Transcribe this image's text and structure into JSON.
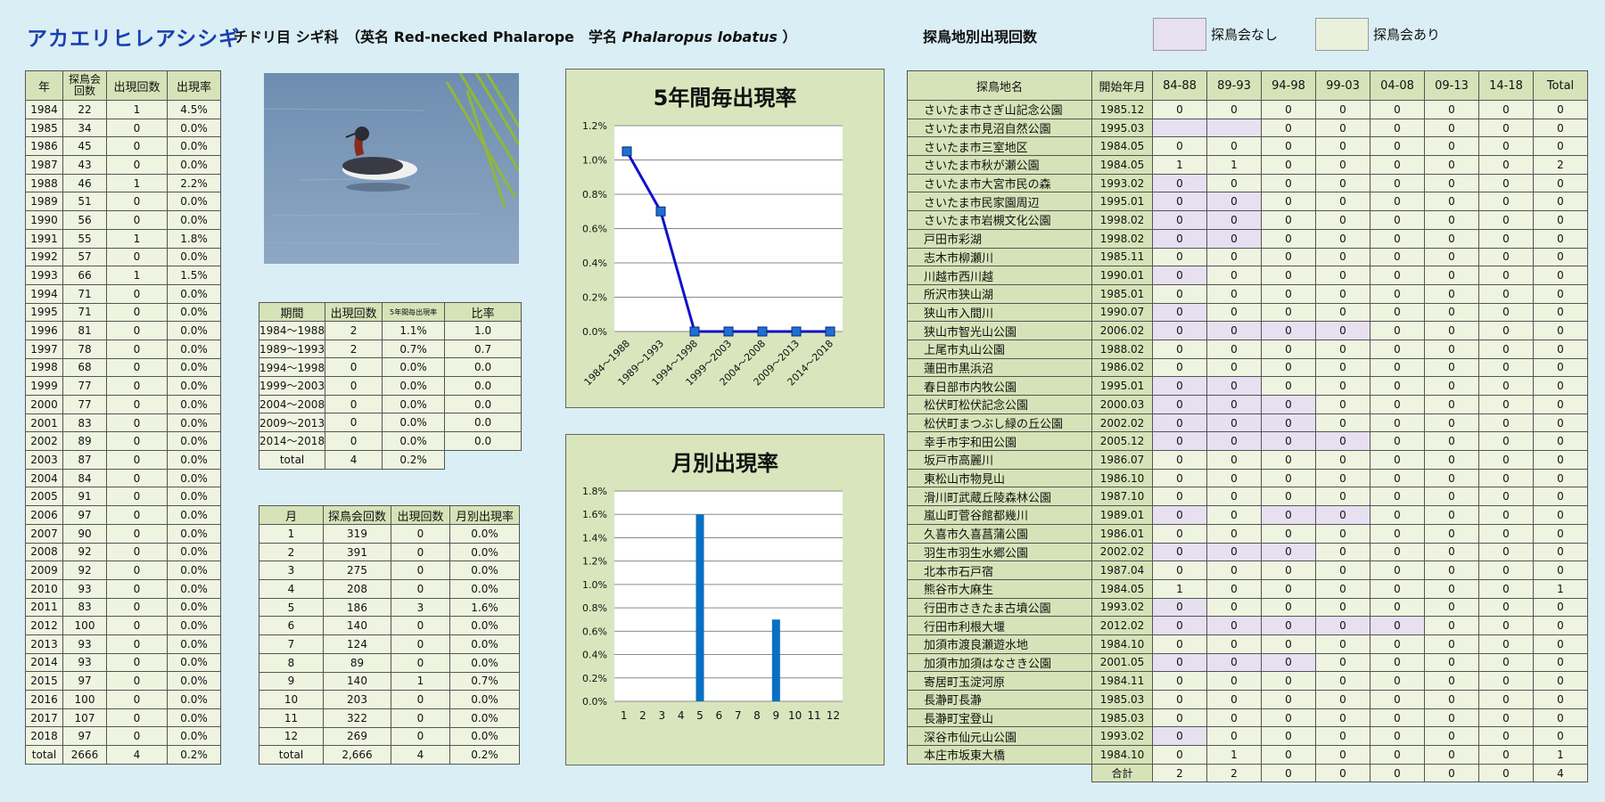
{
  "header": {
    "species": "アカエリヒレアシシギ",
    "order_family": "チドリ目 シギ科",
    "names_open": "（英名 Red-necked Phalarope　学名 ",
    "scientific": "Phalaropus lobatus",
    "names_close": " ）",
    "sites_title": "探鳥地別出現回数",
    "legend_no": "探鳥会なし",
    "legend_yes": "探鳥会あり"
  },
  "colors": {
    "no_meeting": "#e6e0f0",
    "meeting": "#e9f1dd",
    "line": "#1212c8",
    "bar": "#0a6fc2"
  },
  "years_table": {
    "headers": [
      "年",
      "探鳥会回数",
      "出現回数",
      "出現率"
    ],
    "rows": [
      [
        "1984",
        "22",
        "1",
        "4.5%"
      ],
      [
        "1985",
        "34",
        "0",
        "0.0%"
      ],
      [
        "1986",
        "45",
        "0",
        "0.0%"
      ],
      [
        "1987",
        "43",
        "0",
        "0.0%"
      ],
      [
        "1988",
        "46",
        "1",
        "2.2%"
      ],
      [
        "1989",
        "51",
        "0",
        "0.0%"
      ],
      [
        "1990",
        "56",
        "0",
        "0.0%"
      ],
      [
        "1991",
        "55",
        "1",
        "1.8%"
      ],
      [
        "1992",
        "57",
        "0",
        "0.0%"
      ],
      [
        "1993",
        "66",
        "1",
        "1.5%"
      ],
      [
        "1994",
        "71",
        "0",
        "0.0%"
      ],
      [
        "1995",
        "71",
        "0",
        "0.0%"
      ],
      [
        "1996",
        "81",
        "0",
        "0.0%"
      ],
      [
        "1997",
        "78",
        "0",
        "0.0%"
      ],
      [
        "1998",
        "68",
        "0",
        "0.0%"
      ],
      [
        "1999",
        "77",
        "0",
        "0.0%"
      ],
      [
        "2000",
        "77",
        "0",
        "0.0%"
      ],
      [
        "2001",
        "83",
        "0",
        "0.0%"
      ],
      [
        "2002",
        "89",
        "0",
        "0.0%"
      ],
      [
        "2003",
        "87",
        "0",
        "0.0%"
      ],
      [
        "2004",
        "84",
        "0",
        "0.0%"
      ],
      [
        "2005",
        "91",
        "0",
        "0.0%"
      ],
      [
        "2006",
        "97",
        "0",
        "0.0%"
      ],
      [
        "2007",
        "90",
        "0",
        "0.0%"
      ],
      [
        "2008",
        "92",
        "0",
        "0.0%"
      ],
      [
        "2009",
        "92",
        "0",
        "0.0%"
      ],
      [
        "2010",
        "93",
        "0",
        "0.0%"
      ],
      [
        "2011",
        "83",
        "0",
        "0.0%"
      ],
      [
        "2012",
        "100",
        "0",
        "0.0%"
      ],
      [
        "2013",
        "93",
        "0",
        "0.0%"
      ],
      [
        "2014",
        "93",
        "0",
        "0.0%"
      ],
      [
        "2015",
        "97",
        "0",
        "0.0%"
      ],
      [
        "2016",
        "100",
        "0",
        "0.0%"
      ],
      [
        "2017",
        "107",
        "0",
        "0.0%"
      ],
      [
        "2018",
        "97",
        "0",
        "0.0%"
      ],
      [
        "total",
        "2666",
        "4",
        "0.2%"
      ]
    ]
  },
  "period_table": {
    "headers": [
      "期間",
      "出現回数",
      "5年間毎出現率",
      "比率"
    ],
    "rows": [
      [
        "1984～1988",
        "2",
        "1.1%",
        "1.0"
      ],
      [
        "1989～1993",
        "2",
        "0.7%",
        "0.7"
      ],
      [
        "1994～1998",
        "0",
        "0.0%",
        "0.0"
      ],
      [
        "1999～2003",
        "0",
        "0.0%",
        "0.0"
      ],
      [
        "2004～2008",
        "0",
        "0.0%",
        "0.0"
      ],
      [
        "2009～2013",
        "0",
        "0.0%",
        "0.0"
      ],
      [
        "2014～2018",
        "0",
        "0.0%",
        "0.0"
      ]
    ],
    "total": [
      "total",
      "4",
      "0.2%"
    ]
  },
  "month_table": {
    "headers": [
      "月",
      "探鳥会回数",
      "出現回数",
      "月別出現率"
    ],
    "rows": [
      [
        "1",
        "319",
        "0",
        "0.0%"
      ],
      [
        "2",
        "391",
        "0",
        "0.0%"
      ],
      [
        "3",
        "275",
        "0",
        "0.0%"
      ],
      [
        "4",
        "208",
        "0",
        "0.0%"
      ],
      [
        "5",
        "186",
        "3",
        "1.6%"
      ],
      [
        "6",
        "140",
        "0",
        "0.0%"
      ],
      [
        "7",
        "124",
        "0",
        "0.0%"
      ],
      [
        "8",
        "89",
        "0",
        "0.0%"
      ],
      [
        "9",
        "140",
        "1",
        "0.7%"
      ],
      [
        "10",
        "203",
        "0",
        "0.0%"
      ],
      [
        "11",
        "322",
        "0",
        "0.0%"
      ],
      [
        "12",
        "269",
        "0",
        "0.0%"
      ],
      [
        "total",
        "2,666",
        "4",
        "0.2%"
      ]
    ]
  },
  "sites_table": {
    "headers": [
      "探鳥地名",
      "開始年月",
      "84-88",
      "89-93",
      "94-98",
      "99-03",
      "04-08",
      "09-13",
      "14-18",
      "Total"
    ],
    "rows": [
      {
        "name": "さいたま市さぎ山記念公園",
        "start": "1985.12",
        "v": [
          "0",
          "0",
          "0",
          "0",
          "0",
          "0",
          "0",
          "0"
        ],
        "nm": []
      },
      {
        "name": "さいたま市見沼自然公園",
        "start": "1995.03",
        "v": [
          "",
          "",
          "0",
          "0",
          "0",
          "0",
          "0",
          "0"
        ],
        "nm": [
          0,
          1
        ]
      },
      {
        "name": "さいたま市三室地区",
        "start": "1984.05",
        "v": [
          "0",
          "0",
          "0",
          "0",
          "0",
          "0",
          "0",
          "0"
        ],
        "nm": []
      },
      {
        "name": "さいたま市秋が瀬公園",
        "start": "1984.05",
        "v": [
          "1",
          "1",
          "0",
          "0",
          "0",
          "0",
          "0",
          "2"
        ],
        "nm": []
      },
      {
        "name": "さいたま市大宮市民の森",
        "start": "1993.02",
        "v": [
          "0",
          "0",
          "0",
          "0",
          "0",
          "0",
          "0",
          "0"
        ],
        "nm": [
          0
        ]
      },
      {
        "name": "さいたま市民家園周辺",
        "start": "1995.01",
        "v": [
          "0",
          "0",
          "0",
          "0",
          "0",
          "0",
          "0",
          "0"
        ],
        "nm": [
          0,
          1
        ]
      },
      {
        "name": "さいたま市岩槻文化公園",
        "start": "1998.02",
        "v": [
          "0",
          "0",
          "0",
          "0",
          "0",
          "0",
          "0",
          "0"
        ],
        "nm": [
          0,
          1
        ]
      },
      {
        "name": "戸田市彩湖",
        "start": "1998.02",
        "v": [
          "0",
          "0",
          "0",
          "0",
          "0",
          "0",
          "0",
          "0"
        ],
        "nm": [
          0,
          1
        ]
      },
      {
        "name": "志木市柳瀬川",
        "start": "1985.11",
        "v": [
          "0",
          "0",
          "0",
          "0",
          "0",
          "0",
          "0",
          "0"
        ],
        "nm": []
      },
      {
        "name": "川越市西川越",
        "start": "1990.01",
        "v": [
          "0",
          "0",
          "0",
          "0",
          "0",
          "0",
          "0",
          "0"
        ],
        "nm": [
          0
        ]
      },
      {
        "name": "所沢市狭山湖",
        "start": "1985.01",
        "v": [
          "0",
          "0",
          "0",
          "0",
          "0",
          "0",
          "0",
          "0"
        ],
        "nm": []
      },
      {
        "name": "狭山市入間川",
        "start": "1990.07",
        "v": [
          "0",
          "0",
          "0",
          "0",
          "0",
          "0",
          "0",
          "0"
        ],
        "nm": [
          0
        ]
      },
      {
        "name": "狭山市智光山公園",
        "start": "2006.02",
        "v": [
          "0",
          "0",
          "0",
          "0",
          "0",
          "0",
          "0",
          "0"
        ],
        "nm": [
          0,
          1,
          2,
          3
        ]
      },
      {
        "name": "上尾市丸山公園",
        "start": "1988.02",
        "v": [
          "0",
          "0",
          "0",
          "0",
          "0",
          "0",
          "0",
          "0"
        ],
        "nm": []
      },
      {
        "name": "蓮田市黒浜沼",
        "start": "1986.02",
        "v": [
          "0",
          "0",
          "0",
          "0",
          "0",
          "0",
          "0",
          "0"
        ],
        "nm": []
      },
      {
        "name": "春日部市内牧公園",
        "start": "1995.01",
        "v": [
          "0",
          "0",
          "0",
          "0",
          "0",
          "0",
          "0",
          "0"
        ],
        "nm": [
          0,
          1
        ]
      },
      {
        "name": "松伏町松伏記念公園",
        "start": "2000.03",
        "v": [
          "0",
          "0",
          "0",
          "0",
          "0",
          "0",
          "0",
          "0"
        ],
        "nm": [
          0,
          1,
          2
        ]
      },
      {
        "name": "松伏町まつぶし緑の丘公園",
        "start": "2002.02",
        "v": [
          "0",
          "0",
          "0",
          "0",
          "0",
          "0",
          "0",
          "0"
        ],
        "nm": [
          0,
          1,
          2
        ]
      },
      {
        "name": "幸手市宇和田公園",
        "start": "2005.12",
        "v": [
          "0",
          "0",
          "0",
          "0",
          "0",
          "0",
          "0",
          "0"
        ],
        "nm": [
          0,
          1,
          2,
          3
        ]
      },
      {
        "name": "坂戸市高麗川",
        "start": "1986.07",
        "v": [
          "0",
          "0",
          "0",
          "0",
          "0",
          "0",
          "0",
          "0"
        ],
        "nm": []
      },
      {
        "name": "東松山市物見山",
        "start": "1986.10",
        "v": [
          "0",
          "0",
          "0",
          "0",
          "0",
          "0",
          "0",
          "0"
        ],
        "nm": []
      },
      {
        "name": "滑川町武蔵丘陵森林公園",
        "start": "1987.10",
        "v": [
          "0",
          "0",
          "0",
          "0",
          "0",
          "0",
          "0",
          "0"
        ],
        "nm": []
      },
      {
        "name": "嵐山町菅谷館都幾川",
        "start": "1989.01",
        "v": [
          "0",
          "0",
          "0",
          "0",
          "0",
          "0",
          "0",
          "0"
        ],
        "nm": [
          0,
          2,
          3
        ]
      },
      {
        "name": "久喜市久喜菖蒲公園",
        "start": "1986.01",
        "v": [
          "0",
          "0",
          "0",
          "0",
          "0",
          "0",
          "0",
          "0"
        ],
        "nm": []
      },
      {
        "name": "羽生市羽生水郷公園",
        "start": "2002.02",
        "v": [
          "0",
          "0",
          "0",
          "0",
          "0",
          "0",
          "0",
          "0"
        ],
        "nm": [
          0,
          1,
          2
        ]
      },
      {
        "name": "北本市石戸宿",
        "start": "1987.04",
        "v": [
          "0",
          "0",
          "0",
          "0",
          "0",
          "0",
          "0",
          "0"
        ],
        "nm": []
      },
      {
        "name": "熊谷市大麻生",
        "start": "1984.05",
        "v": [
          "1",
          "0",
          "0",
          "0",
          "0",
          "0",
          "0",
          "1"
        ],
        "nm": []
      },
      {
        "name": "行田市さきたま古墳公園",
        "start": "1993.02",
        "v": [
          "0",
          "0",
          "0",
          "0",
          "0",
          "0",
          "0",
          "0"
        ],
        "nm": [
          0
        ]
      },
      {
        "name": "行田市利根大堰",
        "start": "2012.02",
        "v": [
          "0",
          "0",
          "0",
          "0",
          "0",
          "0",
          "0",
          "0"
        ],
        "nm": [
          0,
          1,
          2,
          3,
          4
        ]
      },
      {
        "name": "加須市渡良瀬遊水地",
        "start": "1984.10",
        "v": [
          "0",
          "0",
          "0",
          "0",
          "0",
          "0",
          "0",
          "0"
        ],
        "nm": []
      },
      {
        "name": "加須市加須はなさき公園",
        "start": "2001.05",
        "v": [
          "0",
          "0",
          "0",
          "0",
          "0",
          "0",
          "0",
          "0"
        ],
        "nm": [
          0,
          1,
          2
        ]
      },
      {
        "name": "寄居町玉淀河原",
        "start": "1984.11",
        "v": [
          "0",
          "0",
          "0",
          "0",
          "0",
          "0",
          "0",
          "0"
        ],
        "nm": []
      },
      {
        "name": "長瀞町長瀞",
        "start": "1985.03",
        "v": [
          "0",
          "0",
          "0",
          "0",
          "0",
          "0",
          "0",
          "0"
        ],
        "nm": []
      },
      {
        "name": "長瀞町宝登山",
        "start": "1985.03",
        "v": [
          "0",
          "0",
          "0",
          "0",
          "0",
          "0",
          "0",
          "0"
        ],
        "nm": []
      },
      {
        "name": "深谷市仙元山公園",
        "start": "1993.02",
        "v": [
          "0",
          "0",
          "0",
          "0",
          "0",
          "0",
          "0",
          "0"
        ],
        "nm": [
          0
        ]
      },
      {
        "name": "本庄市坂東大橋",
        "start": "1984.10",
        "v": [
          "0",
          "1",
          "0",
          "0",
          "0",
          "0",
          "0",
          "1"
        ],
        "nm": []
      }
    ],
    "total_label": "合計",
    "totals": [
      "2",
      "2",
      "0",
      "0",
      "0",
      "0",
      "0",
      "4"
    ]
  },
  "chart_data": [
    {
      "type": "line",
      "title": "5年間毎出現率",
      "categories": [
        "1984～1988",
        "1989～1993",
        "1994～1998",
        "1999～2003",
        "2004～2008",
        "2009～2013",
        "2014～2018"
      ],
      "values": [
        1.05,
        0.7,
        0.0,
        0.0,
        0.0,
        0.0,
        0.0
      ],
      "y_ticks": [
        "0.0%",
        "0.2%",
        "0.4%",
        "0.6%",
        "0.8%",
        "1.0%",
        "1.2%"
      ],
      "ylim": [
        0,
        1.2
      ],
      "xlabel": "",
      "ylabel": "",
      "grid": true,
      "legend": "none"
    },
    {
      "type": "bar",
      "title": "月別出現率",
      "categories": [
        "1",
        "2",
        "3",
        "4",
        "5",
        "6",
        "7",
        "8",
        "9",
        "10",
        "11",
        "12"
      ],
      "values": [
        0,
        0,
        0,
        0,
        1.6,
        0,
        0,
        0,
        0.7,
        0,
        0,
        0
      ],
      "y_ticks": [
        "0.0%",
        "0.2%",
        "0.4%",
        "0.6%",
        "0.8%",
        "1.0%",
        "1.2%",
        "1.4%",
        "1.6%",
        "1.8%"
      ],
      "ylim": [
        0,
        1.8
      ],
      "xlabel": "",
      "ylabel": "",
      "grid": true,
      "legend": "none"
    }
  ]
}
